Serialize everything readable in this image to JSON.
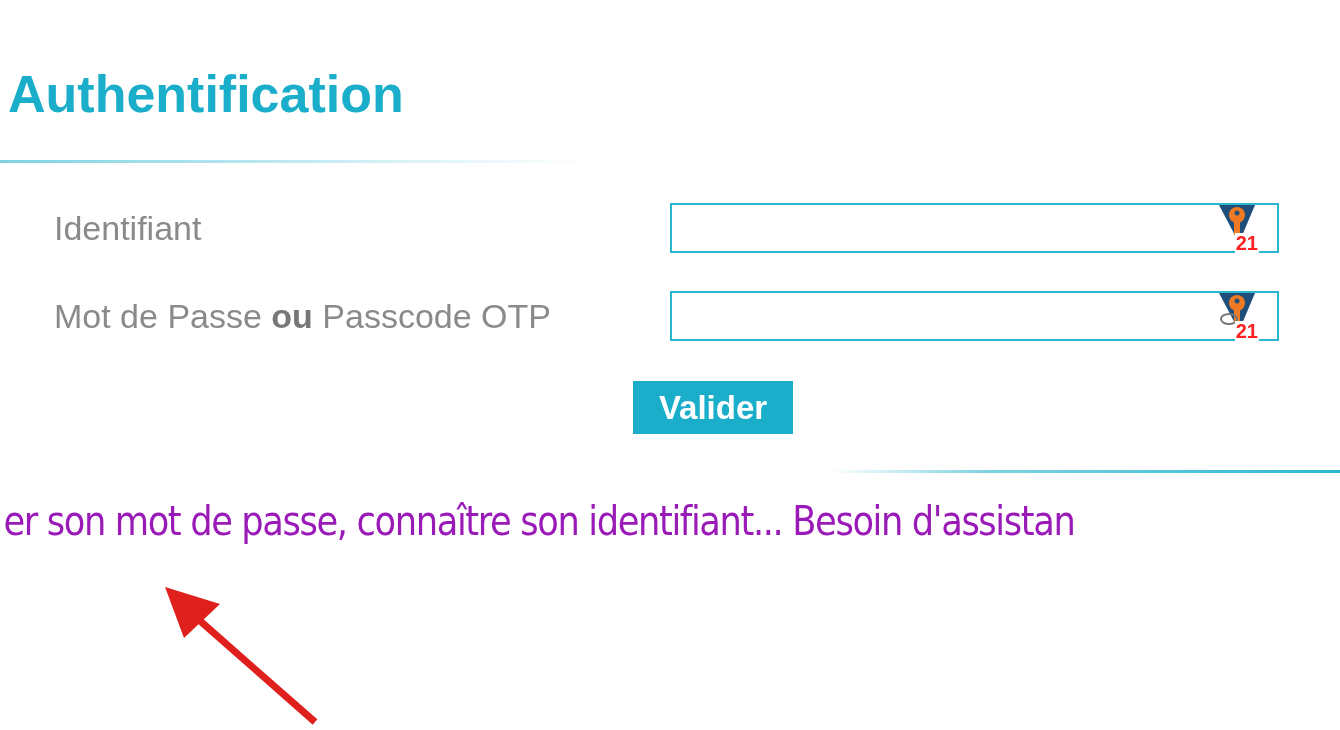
{
  "title": "Authentification",
  "fields": [
    {
      "label": "Identifiant",
      "badge": "21",
      "kind": "text"
    },
    {
      "label": "Mot de Passe **ou** Passcode OTP",
      "badge": "21",
      "kind": "password"
    }
  ],
  "submit": "Valider",
  "marquee": "er son mot de passe, connaître son identifiant... Besoin d'assistan"
}
